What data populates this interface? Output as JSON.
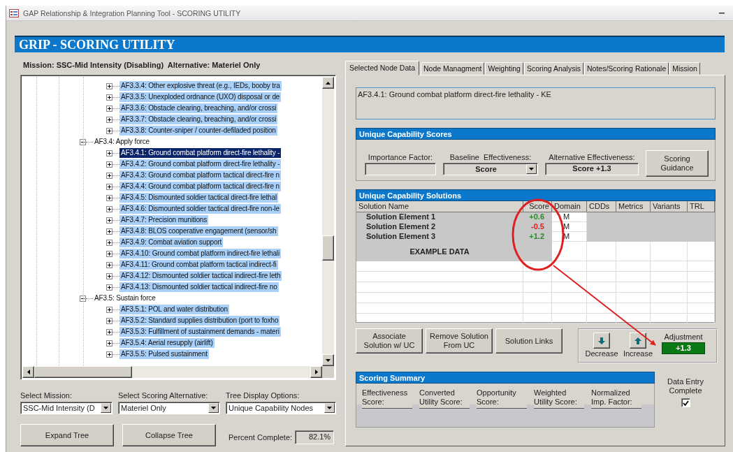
{
  "window": {
    "title": "GAP Relationship & Integration Planning Tool - SCORING UTILITY"
  },
  "header": {
    "title": "GRIP - SCORING UTILITY"
  },
  "context": "Mission: SSC-Mid Intensity (Disabling)  Alternative: Materiel Only",
  "tree": {
    "items": [
      {
        "children": [
          {
            "label": "AF3.3.4: Other explosive threat (e.g., IEDs, booby tra",
            "expanded": false,
            "selected": false,
            "highlighted": true
          },
          {
            "label": "AF3.3.5: Unexploded ordnance (UXO) disposal or de",
            "expanded": false,
            "selected": false,
            "highlighted": true
          },
          {
            "label": "AF3.3.6: Obstacle clearing, breaching, and/or crossi",
            "expanded": false,
            "selected": false,
            "highlighted": true
          },
          {
            "label": "AF3.3.7: Obstacle clearing, breaching, and/or crossi",
            "expanded": false,
            "selected": false,
            "highlighted": true
          },
          {
            "label": "AF3.3.8: Counter-sniper / counter-defiladed position",
            "expanded": false,
            "selected": false,
            "highlighted": true
          }
        ]
      },
      {
        "label": "AF3.4: Apply force",
        "expanded": true,
        "selected": false,
        "highlighted": false,
        "children": [
          {
            "label": "AF3.4.1: Ground combat platform direct-fire lethality -",
            "expanded": false,
            "selected": true,
            "highlighted": true
          },
          {
            "label": "AF3.4.2: Ground combat platform direct-fire lethality -",
            "expanded": false,
            "selected": false,
            "highlighted": true
          },
          {
            "label": "AF3.4.3: Ground combat platform tactical direct-fire n",
            "expanded": false,
            "selected": false,
            "highlighted": true
          },
          {
            "label": "AF3.4.4: Ground combat platform tactical direct-fire n",
            "expanded": false,
            "selected": false,
            "highlighted": true
          },
          {
            "label": "AF3.4.5: Dismounted soldier tactical direct-fire lethal",
            "expanded": false,
            "selected": false,
            "highlighted": true
          },
          {
            "label": "AF3.4.6: Dismounted soldier tactical direct-fire non-le",
            "expanded": false,
            "selected": false,
            "highlighted": true
          },
          {
            "label": "AF3.4.7: Precision munitions",
            "expanded": false,
            "selected": false,
            "highlighted": true
          },
          {
            "label": "AF3.4.8: BLOS cooperative engagement (sensor/sh",
            "expanded": false,
            "selected": false,
            "highlighted": true
          },
          {
            "label": "AF3.4.9: Combat aviation support",
            "expanded": false,
            "selected": false,
            "highlighted": true
          },
          {
            "label": "AF3.4.10: Ground combat platform indirect-fire lethali",
            "expanded": false,
            "selected": false,
            "highlighted": true
          },
          {
            "label": "AF3.4.11: Ground combat platform tactical indirect-fi",
            "expanded": false,
            "selected": false,
            "highlighted": true
          },
          {
            "label": "AF3.4.12: Dismounted soldier tactical indirect-fire leth",
            "expanded": false,
            "selected": false,
            "highlighted": true
          },
          {
            "label": "AF3.4.13: Dismounted soldier tactical indirect-fire no",
            "expanded": false,
            "selected": false,
            "highlighted": true
          }
        ]
      },
      {
        "label": "AF3.5: Sustain force",
        "expanded": true,
        "selected": false,
        "highlighted": false,
        "children": [
          {
            "label": "AF3.5.1: POL and water distribution",
            "expanded": false,
            "selected": false,
            "highlighted": true
          },
          {
            "label": "AF3.5.2: Standard supplies distribution (port to foxho",
            "expanded": false,
            "selected": false,
            "highlighted": true
          },
          {
            "label": "AF3.5.3: Fulfillment of sustainment demands - materi",
            "expanded": false,
            "selected": false,
            "highlighted": true
          },
          {
            "label": "AF3.5.4: Aerial resupply (airlift)",
            "expanded": false,
            "selected": false,
            "highlighted": true
          },
          {
            "label": "AF3.5.5: Pulsed sustainment",
            "expanded": false,
            "selected": false,
            "highlighted": true
          }
        ]
      }
    ]
  },
  "mission_select": {
    "label": "Select Mission:",
    "value": "SSC-Mid Intensity (D"
  },
  "alternative_select": {
    "label": "Select Scoring Alternative:",
    "value": "Materiel Only"
  },
  "tree_display_select": {
    "label": "Tree Display Options:",
    "value": "Unique Capability Nodes"
  },
  "tree_buttons": [
    "Expand Tree",
    "Collapse Tree"
  ],
  "percent_complete": {
    "label": "Percent Complete:",
    "value": "82.1%"
  },
  "tabs": [
    {
      "label": "Selected Node Data",
      "selected": true
    },
    {
      "label": "Node Managment",
      "selected": false
    },
    {
      "label": "Weighting",
      "selected": false
    },
    {
      "label": "Scoring Analysis",
      "selected": false
    },
    {
      "label": "Notes/Scoring Rationale",
      "selected": false
    },
    {
      "label": "Mission",
      "selected": false
    }
  ],
  "node_description": "AF3.4.1: Ground combat platform direct-fire lethality - KE",
  "capability_scores": {
    "title": "Unique Capability Scores",
    "importance_label": "Importance Factor:",
    "baseline_label": "Baseline  Effectiveness:",
    "baseline_value": "Score",
    "alternative_label": "Alternative Effectiveness:",
    "alternative_value": "Score +1.3",
    "guidance_button": "Scoring Guidance"
  },
  "solutions": {
    "title": "Unique Capability Solutions",
    "columns": [
      "Solution Name",
      "Score",
      "Domain",
      "CDDs",
      "Metrics",
      "Variants",
      "TRL"
    ],
    "rows": [
      {
        "name": "Solution Element 1",
        "score": "+0.6",
        "color": "#2a8a2a",
        "domain": "M"
      },
      {
        "name": "Solution Element 2",
        "score": "-0.5",
        "color": "#d42020",
        "domain": "M"
      },
      {
        "name": "Solution Element 3",
        "score": "+1.2",
        "color": "#2a8a2a",
        "domain": "M"
      }
    ],
    "note": "EXAMPLE DATA"
  },
  "solution_buttons": [
    "Associate Solution w/ UC",
    "Remove Solution From UC",
    "Solution Links"
  ],
  "adjustment": {
    "decrease": "Decrease",
    "increase": "Increase",
    "label": "Adjustment",
    "value": "+1.3"
  },
  "scoring_summary": {
    "title": "Scoring Summary",
    "fields": [
      "Effectiveness Score:",
      "Converted Utility Score:",
      "Opportunity Score:",
      "Weighted Utility Score:",
      "Normalized Imp. Factor:"
    ]
  },
  "data_entry_complete": {
    "label": "Data Entry Complete",
    "checked": true
  }
}
